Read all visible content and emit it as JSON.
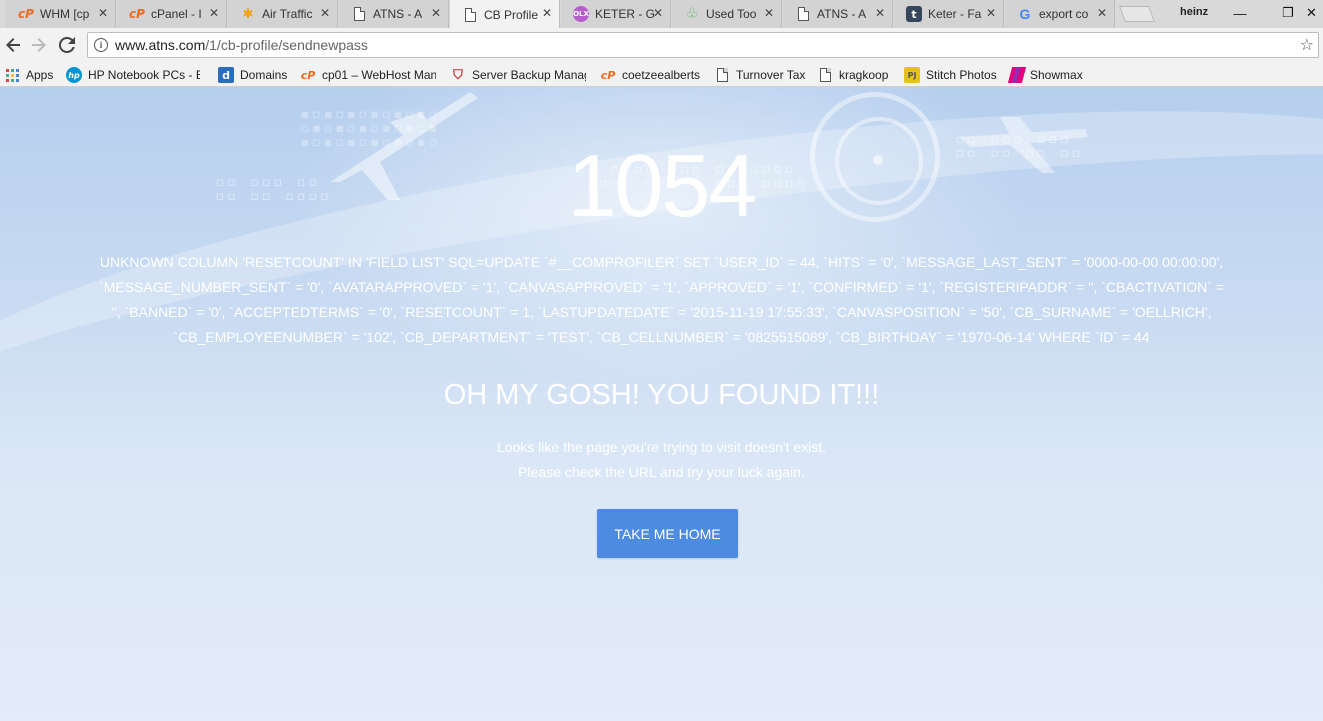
{
  "tabs": [
    {
      "label": "WHM [cp",
      "icon": "cpanel-icon"
    },
    {
      "label": "cPanel - I",
      "icon": "cpanel-icon"
    },
    {
      "label": "Air Traffic",
      "icon": "air-traffic-icon"
    },
    {
      "label": "ATNS - A",
      "icon": "document-icon"
    },
    {
      "label": "CB Profile",
      "icon": "document-icon",
      "active": true
    },
    {
      "label": "KETER - G",
      "icon": "olx-icon"
    },
    {
      "label": "Used Too",
      "icon": "tools-icon"
    },
    {
      "label": "ATNS - A",
      "icon": "document-icon"
    },
    {
      "label": "Keter - Fa",
      "icon": "tumblr-icon"
    },
    {
      "label": "export co",
      "icon": "google-icon"
    }
  ],
  "tab_close_glyph": "✕",
  "window": {
    "profile_name": "heinz",
    "minimize": "—",
    "restore": "❐",
    "close": "✕"
  },
  "address_bar": {
    "domain": "www.atns.com",
    "path": "/1/cb-profile/sendnewpass"
  },
  "bookmarks": [
    {
      "label": "Apps"
    },
    {
      "label": "HP Notebook PCs - B"
    },
    {
      "label": "Domains"
    },
    {
      "label": "cp01 – WebHost Man"
    },
    {
      "label": "Server Backup Manag"
    },
    {
      "label": "coetzeealberts"
    },
    {
      "label": "Turnover Tax"
    },
    {
      "label": "kragkoop"
    },
    {
      "label": "Stitch Photos"
    },
    {
      "label": "Showmax"
    }
  ],
  "page": {
    "error_code": "1054",
    "error_message": "Unknown column 'resetcount' in 'field list' SQL=UPDATE `#__comprofiler` SET `user_id` = 44, `hits` = '0', `message_last_sent` = '0000-00-00 00:00:00', `message_number_sent` = '0', `avatarapproved` = '1', `canvasapproved` = '1', `approved` = '1', `confirmed` = '1', `registeripaddr` = '', `cbactivation` = '', `banned` = '0', `acceptedterms` = '0', `resetcount` = 1, `lastupdatedate` = '2015-11-19 17:55:33', `canvasposition` = '50', `cb_surname` = 'Oellrich', `cb_employeenumber` = '102', `cb_department` = 'Test', `cb_cellnumber` = '0825515089', `cb_birthday` = '1970-06-14' WHERE `id` = 44",
    "headline": "OH MY GOSH! YOU FOUND IT!!!",
    "subtext_line1": "Looks like the page you're trying to visit doesn't exist.",
    "subtext_line2": "Please check the URL and try your luck again.",
    "button_label": "TAKE ME HOME"
  },
  "colors": {
    "button": "#4d8be0",
    "page_top": "#b6cfee",
    "page_bottom": "#e3ecf8"
  }
}
